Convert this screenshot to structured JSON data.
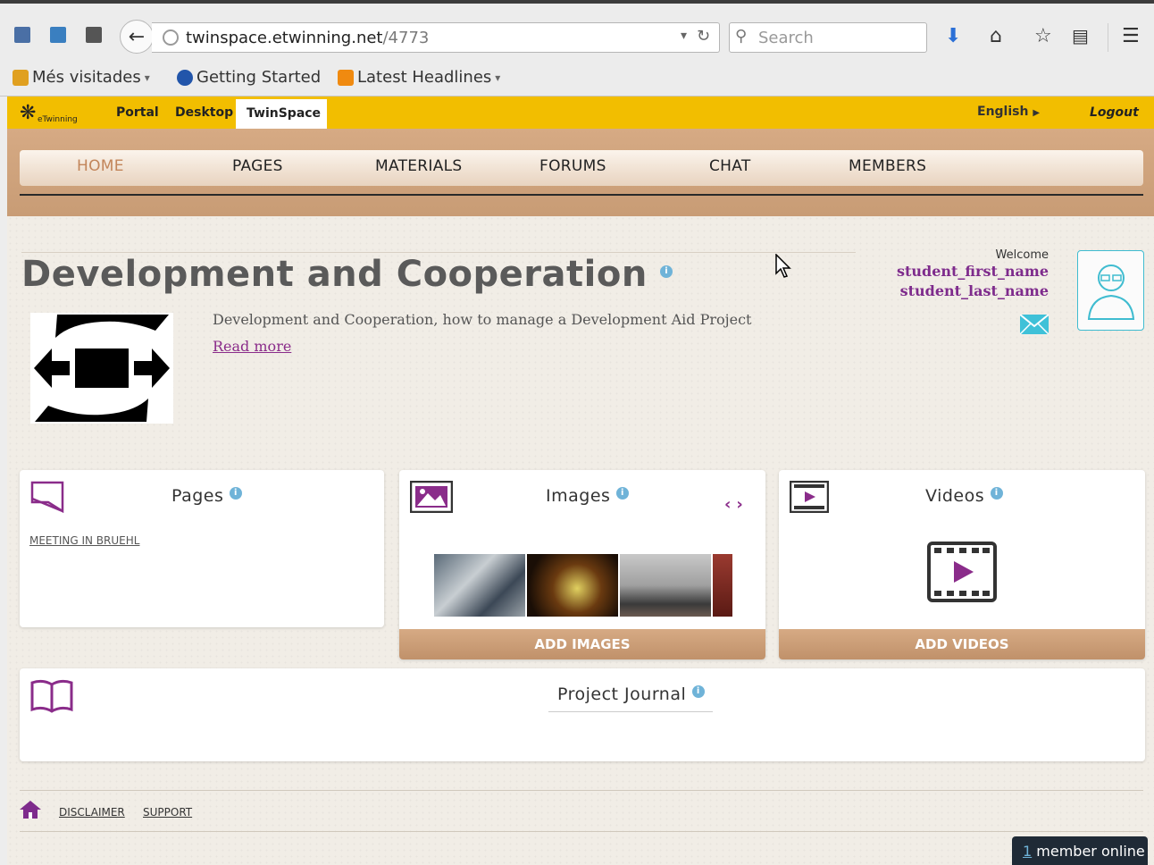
{
  "browser": {
    "url_host": "twinspace.etwinning.net",
    "url_path": "/4773",
    "search_placeholder": "Search",
    "bookmarks": [
      "Més visitades",
      "Getting Started",
      "Latest Headlines"
    ]
  },
  "topbar": {
    "logo_text": "eTwinning",
    "links": [
      "Portal",
      "Desktop"
    ],
    "active_tab": "TwinSpace",
    "language": "English",
    "logout": "Logout"
  },
  "nav": {
    "items": [
      "HOME",
      "PAGES",
      "MATERIALS",
      "FORUMS",
      "CHAT",
      "MEMBERS"
    ]
  },
  "project": {
    "title": "Development and Cooperation",
    "description": "Development and Cooperation, how to manage a Development Aid Project",
    "read_more": "Read more"
  },
  "user": {
    "welcome": "Welcome",
    "first_name": "student_first_name",
    "last_name": "student_last_name"
  },
  "cards": {
    "pages": {
      "title": "Pages",
      "link": "MEETING IN BRUEHL"
    },
    "images": {
      "title": "Images",
      "footer": "ADD IMAGES"
    },
    "videos": {
      "title": "Videos",
      "footer": "ADD VIDEOS"
    },
    "journal": {
      "title": "Project Journal"
    }
  },
  "footer": {
    "links": [
      "DISCLAIMER",
      "SUPPORT"
    ],
    "online_count": "1",
    "online_label": " member online"
  },
  "colors": {
    "accent_yellow": "#f2be00",
    "purple": "#7e2b8c",
    "tan": "#c89c75",
    "info_blue": "#6fb3d8"
  }
}
